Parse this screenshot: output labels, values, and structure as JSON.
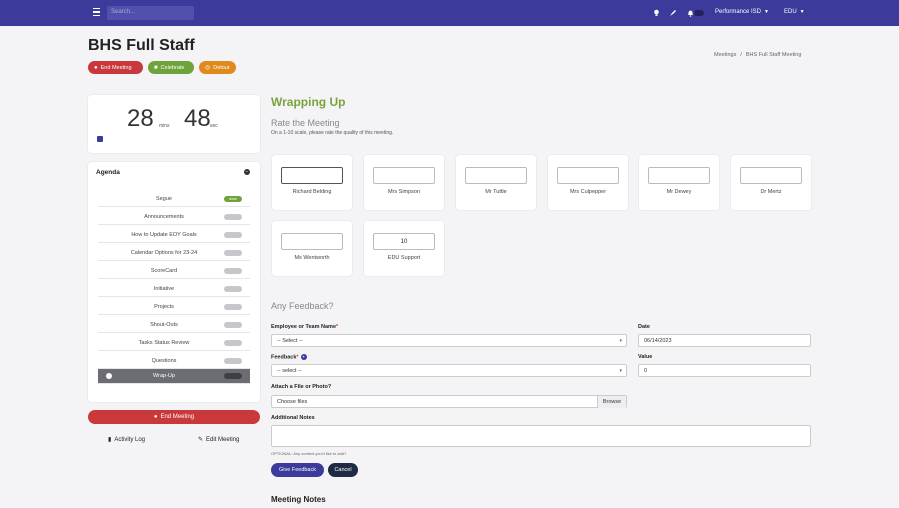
{
  "topbar": {
    "search_placeholder": "Search...",
    "org_menu": "Performance ISD",
    "user_menu": "EDU"
  },
  "header": {
    "title": "BHS Full Staff",
    "actions": {
      "end_meeting": "End Meeting",
      "celebrate": "Celebrate",
      "detour": "Detour"
    },
    "breadcrumb": [
      "Meetings",
      "/",
      "BHS Full Staff Meeting"
    ]
  },
  "timer": {
    "minutes": "28",
    "minutes_unit": "mins",
    "seconds": "48",
    "seconds_unit": "sec"
  },
  "agenda": {
    "title": "Agenda",
    "items": [
      {
        "label": "Segue",
        "badge": "done",
        "state": "done"
      },
      {
        "label": "Announcements",
        "badge": "",
        "state": "pending"
      },
      {
        "label": "How to Update EOY Goals",
        "badge": "",
        "state": "pending"
      },
      {
        "label": "Calendar Options for 23-24",
        "badge": "",
        "state": "pending"
      },
      {
        "label": "ScoreCard",
        "badge": "",
        "state": "pending"
      },
      {
        "label": "Initiative",
        "badge": "",
        "state": "pending"
      },
      {
        "label": "Projects",
        "badge": "",
        "state": "pending"
      },
      {
        "label": "Shout-Outs",
        "badge": "",
        "state": "pending"
      },
      {
        "label": "Tasks Status Review",
        "badge": "",
        "state": "pending"
      },
      {
        "label": "Questions",
        "badge": "",
        "state": "pending"
      },
      {
        "label": "Wrap-Up",
        "badge": "",
        "state": "active"
      }
    ]
  },
  "sidebar_actions": {
    "end_meeting": "End Meeting",
    "activity_log": "Activity Log",
    "edit_meeting": "Edit Meeting"
  },
  "wrap_up": {
    "title": "Wrapping Up",
    "rate_title": "Rate the Meeting",
    "rate_subtitle": "On a 1-10 scale, please rate the quality of this meeting.",
    "ratings": [
      {
        "name": "Richard Belding",
        "value": ""
      },
      {
        "name": "Mrs Simpson",
        "value": ""
      },
      {
        "name": "Mr Tuttle",
        "value": ""
      },
      {
        "name": "Mrs Culpepper",
        "value": ""
      },
      {
        "name": "Mr Dewey",
        "value": ""
      },
      {
        "name": "Dr Mertz",
        "value": ""
      },
      {
        "name": "Ms Wentworth",
        "value": ""
      },
      {
        "name": "EDU Support",
        "value": "10"
      }
    ]
  },
  "feedback": {
    "title": "Any Feedback?",
    "employee_label": "Employee or Team Name",
    "employee_value": "-- Select --",
    "date_label": "Date",
    "date_value": "06/14/2023",
    "feedback_label": "Feedback",
    "feedback_value": "-- select --",
    "value_label": "Value",
    "value_value": "0",
    "attach_label": "Attach a File or Photo?",
    "file_value": "Choose files",
    "browse_label": "Browse",
    "notes_label": "Additional Notes",
    "notes_help": "OPTIONAL: Any context you'd like to add?",
    "give_feedback": "Give Feedback",
    "cancel": "Cancel",
    "required_mark": "*"
  },
  "meeting_notes": {
    "title": "Meeting Notes"
  },
  "colors": {
    "topbar": "#3c3a9b",
    "end_meeting": "#c9383a",
    "celebrate": "#6da33a",
    "detour": "#e08a1e",
    "wrap_title": "#7aa33d"
  }
}
